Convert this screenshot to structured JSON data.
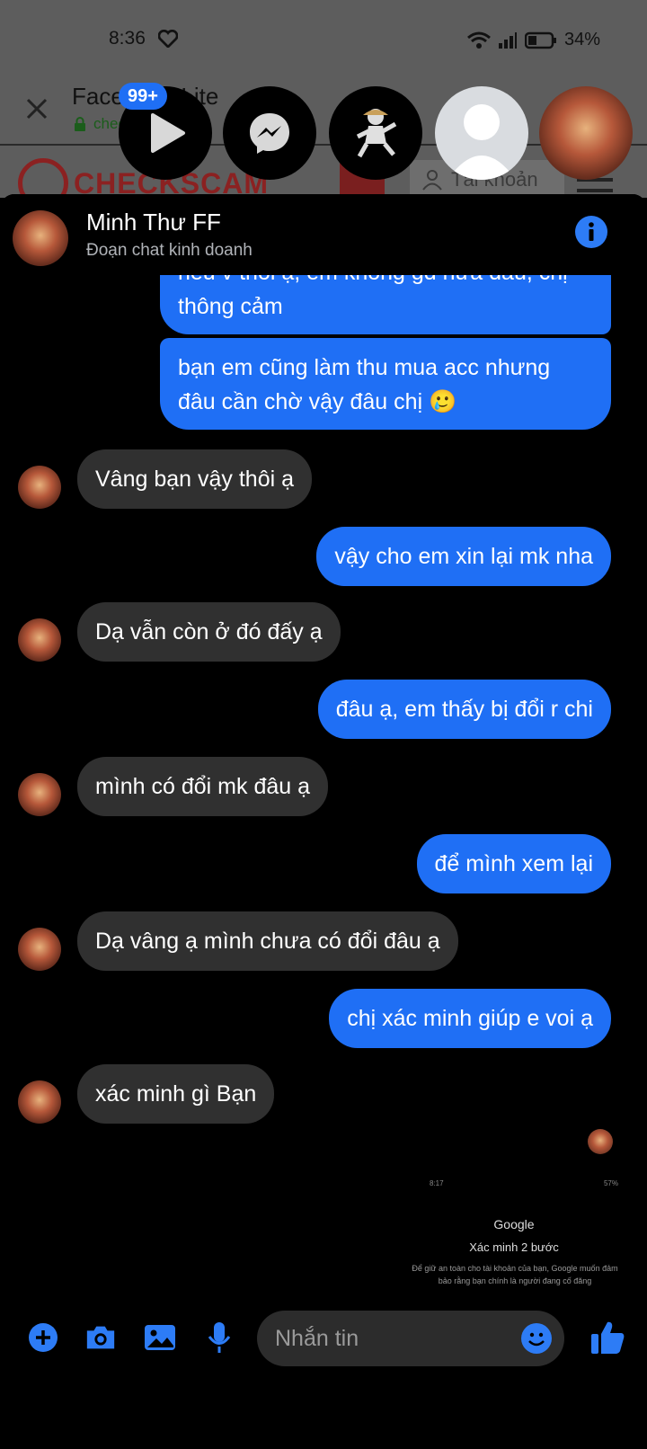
{
  "status_bar": {
    "time": "8:36",
    "battery_pct": "34%"
  },
  "browser": {
    "title": "Facebook Lite",
    "url": "checkscam.com",
    "site_logo_text": "CHECKSCAM",
    "account_label": "Tài khoản"
  },
  "chat_heads": {
    "badge": "99+"
  },
  "chat": {
    "name": "Minh Thư FF",
    "subtitle": "Đoạn chat kinh doanh",
    "messages": [
      {
        "dir": "out",
        "text": "nếu v thôi ạ, em không gd nữa đâu, chị"
      },
      {
        "dir": "out",
        "text": "thông cảm"
      },
      {
        "dir": "out",
        "text": "bạn em cũng làm thu mua acc nhưng"
      },
      {
        "dir": "out",
        "text": "đâu cần chờ vậy đâu chị 🥲"
      },
      {
        "dir": "in",
        "text": "Vâng bạn vậy thôi ạ"
      },
      {
        "dir": "out",
        "text": "vậy cho em xin lại mk nha"
      },
      {
        "dir": "in",
        "text": "Dạ vẫn còn ở đó đấy ạ"
      },
      {
        "dir": "out",
        "text": "đâu ạ, em thấy bị đổi r chi"
      },
      {
        "dir": "in",
        "text": "mình có đổi mk đâu ạ"
      },
      {
        "dir": "out",
        "text": "để mình xem lại"
      },
      {
        "dir": "in",
        "text": "Dạ vâng ạ mình chưa có đổi đâu ạ"
      },
      {
        "dir": "out",
        "text": "chị xác minh giúp e voi ạ"
      },
      {
        "dir": "in",
        "text": "xác minh gì Bạn"
      }
    ],
    "preview": {
      "status_left": "8:17",
      "status_right": "57%",
      "brand": "Google",
      "title": "Xác minh 2 bước",
      "body": "Để giữ an toàn cho tài khoản của bạn, Google muốn đảm bảo rằng bạn chính là người đang cố đăng"
    }
  },
  "composer": {
    "placeholder": "Nhắn tin"
  },
  "colors": {
    "accent": "#1f6ff5",
    "incoming_bubble": "#303030"
  }
}
